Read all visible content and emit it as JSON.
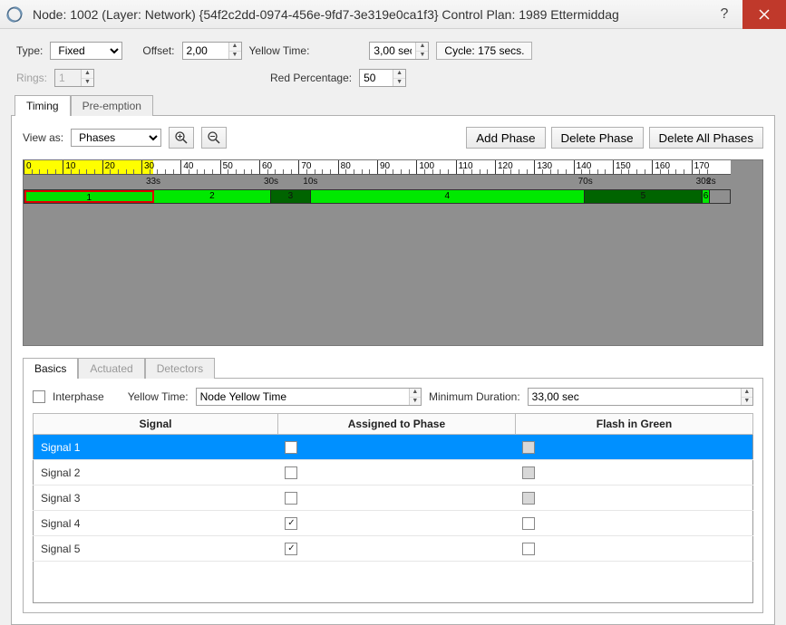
{
  "title": "Node: 1002 (Layer: Network) {54f2c2dd-0974-456e-9fd7-3e319e0ca1f3} Control Plan: 1989 Ettermiddag",
  "labels": {
    "type": "Type:",
    "offset": "Offset:",
    "yellowTime": "Yellow Time:",
    "cycle": "Cycle: 175 secs.",
    "rings": "Rings:",
    "redPct": "Red Percentage:",
    "viewAs": "View as:",
    "interphase": "Interphase",
    "yellowTime2": "Yellow Time:",
    "minDur": "Minimum Duration:"
  },
  "fields": {
    "type": "Fixed",
    "offset": "2,00",
    "yellowTimeSec": "3,00 sec",
    "rings": "1",
    "redPct": "50",
    "viewAs": "Phases",
    "nodeYellow": "Node Yellow Time",
    "minDur": "33,00 sec"
  },
  "tabs": {
    "timing": "Timing",
    "preemption": "Pre-emption",
    "basics": "Basics",
    "actuated": "Actuated",
    "detectors": "Detectors"
  },
  "buttons": {
    "addPhase": "Add Phase",
    "deletePhase": "Delete Phase",
    "deleteAll": "Delete All Phases"
  },
  "timeline": {
    "yellowEndSec": 33,
    "totalSec": 180,
    "majorStep": 10,
    "segments": [
      {
        "label": "1",
        "startSec": 0,
        "widthSec": 33,
        "cls": "seg1",
        "durLabel": "33s"
      },
      {
        "label": "2",
        "startSec": 33,
        "widthSec": 30,
        "cls": "seg-light",
        "durLabel": "30s"
      },
      {
        "label": "3",
        "startSec": 63,
        "widthSec": 10,
        "cls": "seg-dark",
        "durLabel": "10s"
      },
      {
        "label": "4",
        "startSec": 73,
        "widthSec": 70,
        "cls": "seg-light",
        "durLabel": "70s"
      },
      {
        "label": "5",
        "startSec": 143,
        "widthSec": 30,
        "cls": "seg-dark",
        "durLabel": "30s"
      },
      {
        "label": "6",
        "startSec": 173,
        "widthSec": 2,
        "cls": "seg-light",
        "durLabel": "2s"
      }
    ]
  },
  "table": {
    "cols": {
      "signal": "Signal",
      "assigned": "Assigned to Phase",
      "flash": "Flash in Green"
    },
    "rows": [
      {
        "signal": "Signal  1",
        "assigned": false,
        "flash": false,
        "flashFilled": true,
        "selected": true
      },
      {
        "signal": "Signal  2",
        "assigned": false,
        "flash": false,
        "flashFilled": true,
        "selected": false
      },
      {
        "signal": "Signal  3",
        "assigned": false,
        "flash": false,
        "flashFilled": true,
        "selected": false
      },
      {
        "signal": "Signal  4",
        "assigned": true,
        "flash": false,
        "flashFilled": false,
        "selected": false
      },
      {
        "signal": "Signal  5",
        "assigned": true,
        "flash": false,
        "flashFilled": false,
        "selected": false
      }
    ]
  }
}
